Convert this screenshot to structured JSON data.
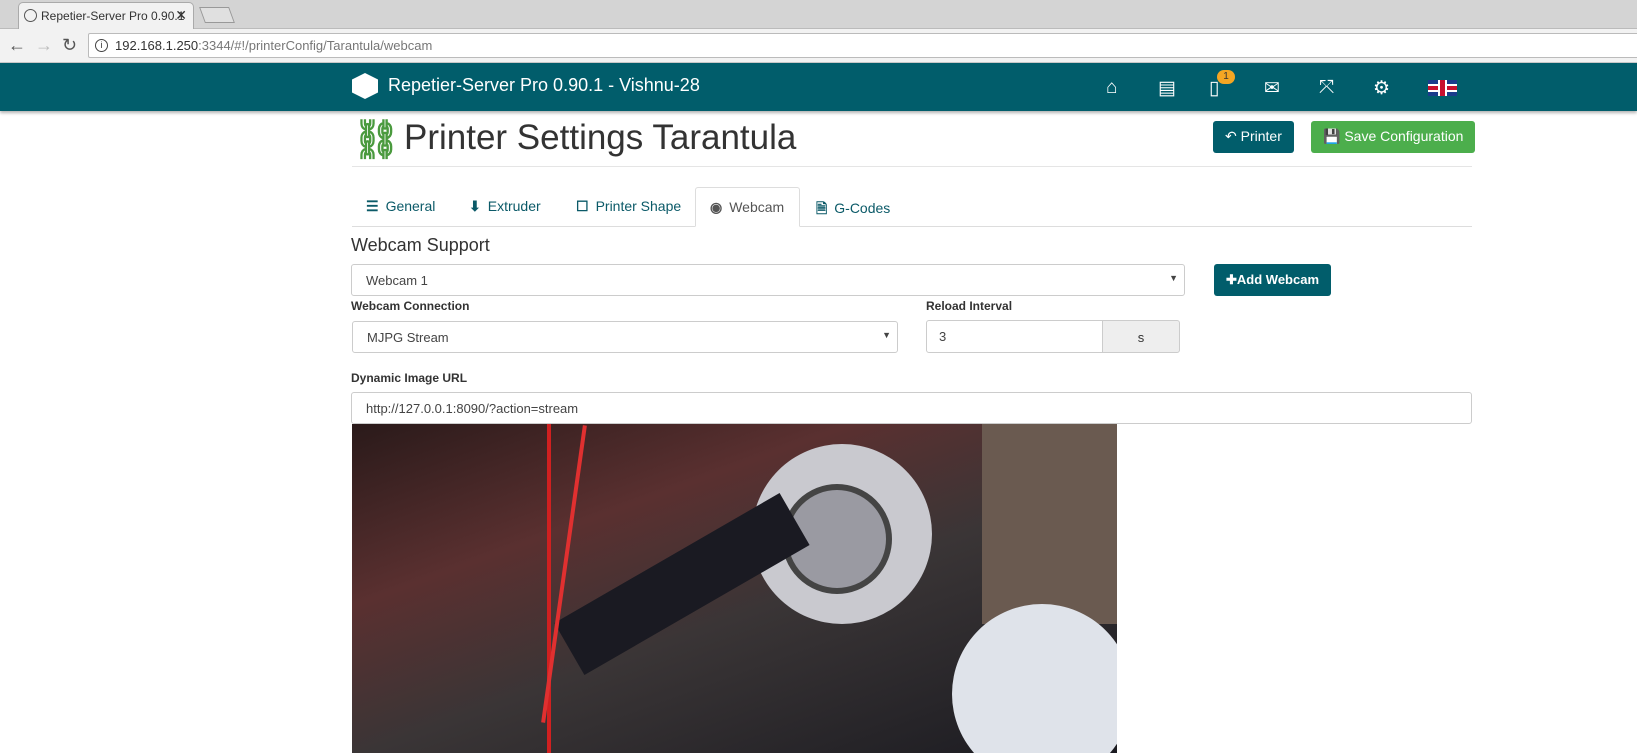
{
  "browser": {
    "tab_title": "Repetier-Server Pro 0.90.1",
    "url_host": "192.168.1.250",
    "url_rest": ":3344/#!/printerConfig/Tarantula/webcam"
  },
  "topbar": {
    "brand": "Repetier-Server Pro 0.90.1 - Vishnu-28",
    "notification_count": "1",
    "icons": [
      "home-icon",
      "archive-icon",
      "printer-icon",
      "mail-icon",
      "fullscreen-icon",
      "gear-icon",
      "uk-flag-icon"
    ]
  },
  "page": {
    "title": "Printer Settings Tarantula",
    "printer_button": "Printer",
    "save_button": "Save Configuration"
  },
  "tabs": [
    {
      "label": "General"
    },
    {
      "label": "Extruder"
    },
    {
      "label": "Printer Shape"
    },
    {
      "label": "Webcam",
      "active": true
    },
    {
      "label": "G-Codes"
    }
  ],
  "webcam": {
    "section_title": "Webcam Support",
    "selected_webcam": "Webcam 1",
    "add_button": "Add Webcam",
    "connection_label": "Webcam Connection",
    "connection_value": "MJPG Stream",
    "reload_label": "Reload Interval",
    "reload_value": "3",
    "reload_unit": "s",
    "url_label": "Dynamic Image URL",
    "url_value": "http://127.0.0.1:8090/?action=stream"
  },
  "colors": {
    "brand": "#015d6b",
    "success": "#4cae4c",
    "badge": "#f5a623"
  }
}
